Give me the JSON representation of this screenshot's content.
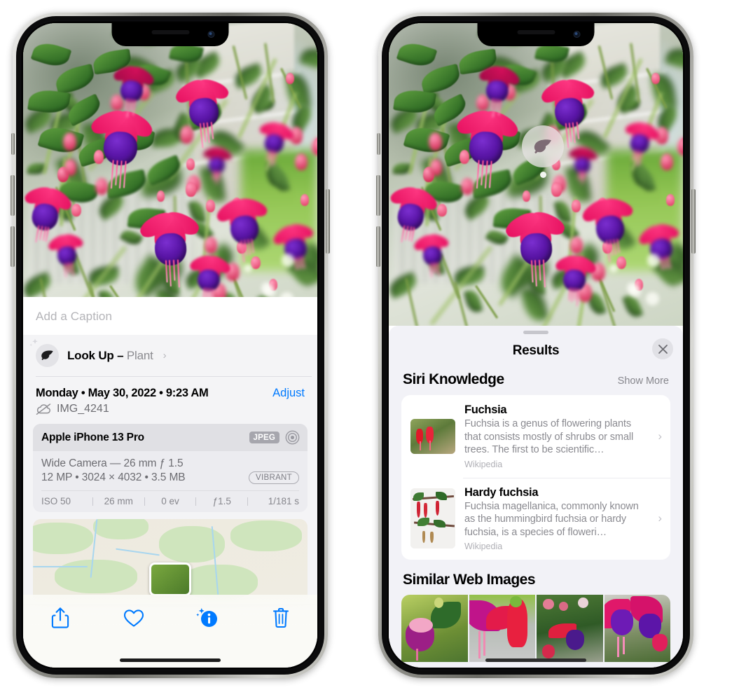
{
  "left_phone": {
    "caption": {
      "placeholder": "Add a Caption",
      "value": ""
    },
    "lookup": {
      "icon": "leaf-icon",
      "sparkle_icon": "sparkle-icon",
      "label": "Look Up – ",
      "subject": "Plant",
      "chevron": "›"
    },
    "metadata": {
      "date": "Monday • May 30, 2022 • 9:23 AM",
      "adjust_label": "Adjust",
      "cloud_icon": "icloud-slash-icon",
      "filename": "IMG_4241"
    },
    "camera": {
      "device": "Apple iPhone 13 Pro",
      "format_badge": "JPEG",
      "aperture_icon": "camera-lens-icon",
      "lens_line": "Wide Camera — 26 mm ƒ 1.5",
      "specs_line": "12 MP • 3024 × 4032 • 3.5 MB",
      "style_badge": "VIBRANT",
      "exif": [
        "ISO 50",
        "26 mm",
        "0 ev",
        "ƒ1.5",
        "1/181 s"
      ]
    },
    "map": {
      "pin": "photo-thumbnail-pin"
    },
    "toolbar": [
      {
        "name": "share-button",
        "icon": "share-icon"
      },
      {
        "name": "favorite-button",
        "icon": "heart-icon"
      },
      {
        "name": "info-button",
        "icon": "info-sparkle-icon"
      },
      {
        "name": "delete-button",
        "icon": "trash-icon"
      }
    ],
    "accent_color": "#007aff"
  },
  "right_phone": {
    "photo_badge": {
      "icon": "leaf-icon",
      "label": "visual-look-up-badge"
    },
    "sheet": {
      "title": "Results",
      "close_icon": "close-icon",
      "sections": [
        {
          "title": "Siri Knowledge",
          "action": "Show More",
          "cards": [
            {
              "title": "Fuchsia",
              "description": "Fuchsia is a genus of flowering plants that consists mostly of shrubs or small trees. The first to be scientific…",
              "source": "Wikipedia",
              "chevron": "›"
            },
            {
              "title": "Hardy fuchsia",
              "description": "Fuchsia magellanica, commonly known as the hummingbird fuchsia or hardy fuchsia, is a species of floweri…",
              "source": "Wikipedia",
              "chevron": "›"
            }
          ]
        },
        {
          "title": "Similar Web Images",
          "images": [
            "fuchsia-thumb-1",
            "fuchsia-thumb-2",
            "fuchsia-thumb-3",
            "fuchsia-thumb-4"
          ]
        }
      ]
    }
  },
  "colors": {
    "accent": "#007aff",
    "sheet_bg": "#f2f2f7",
    "panel_bg": "#f4f4f6",
    "card_bg": "#ffffff",
    "secondary_text": "#8a8a90"
  }
}
